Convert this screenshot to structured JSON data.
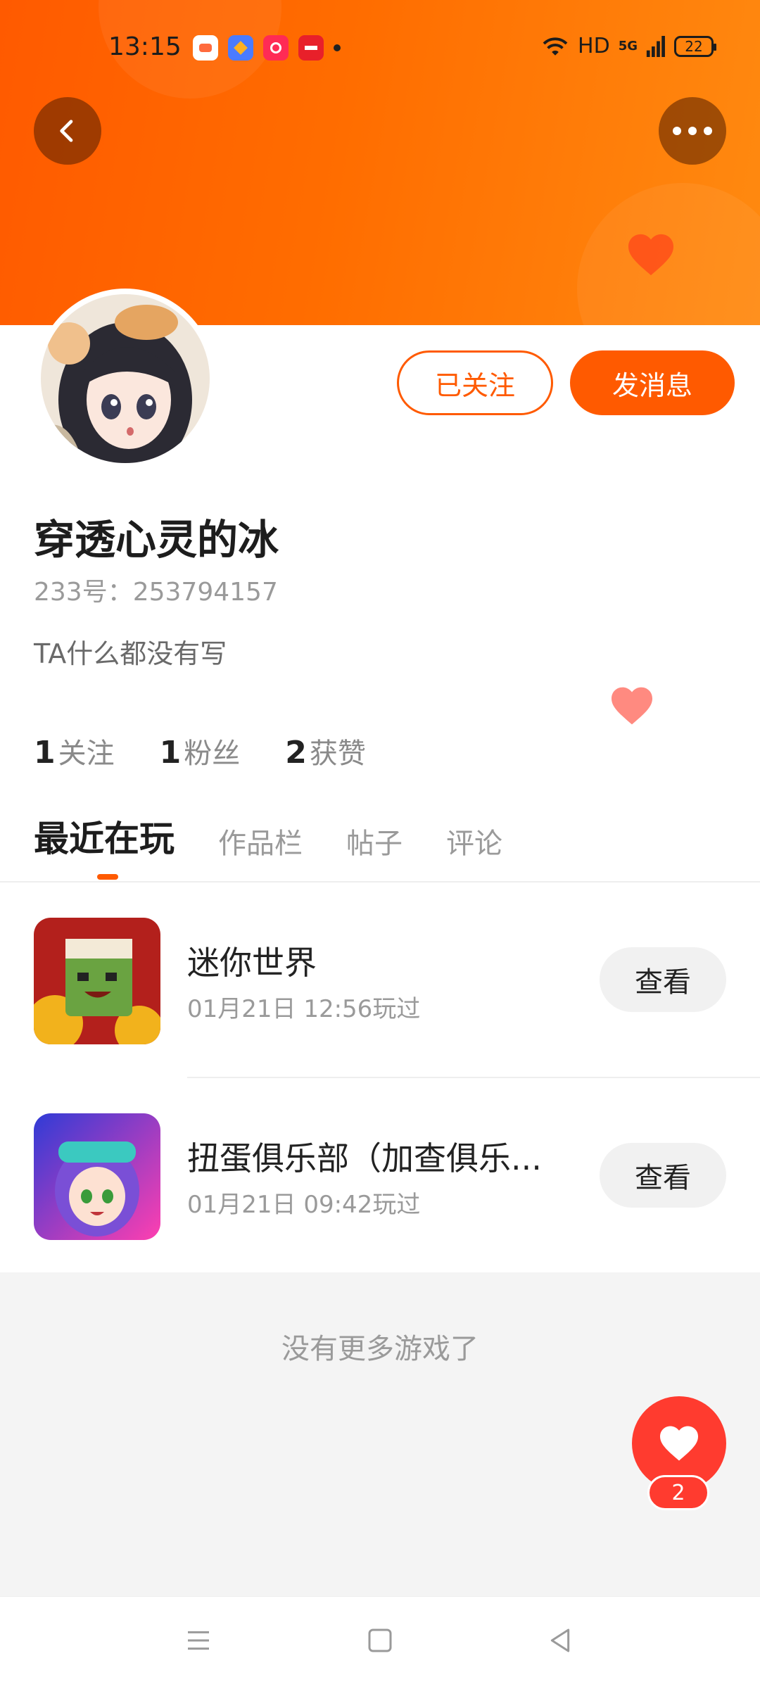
{
  "status_bar": {
    "time": "13:15",
    "network": "HD",
    "signal": "5G",
    "battery": "22"
  },
  "profile": {
    "username": "穿透心灵的冰",
    "uid": "233号：253794157",
    "bio": "TA什么都没有写",
    "follow_label": "已关注",
    "message_label": "发消息",
    "stats": {
      "following_count": "1",
      "following_label": "关注",
      "fans_count": "1",
      "fans_label": "粉丝",
      "likes_count": "2",
      "likes_label": "获赞"
    }
  },
  "tabs": [
    {
      "label": "最近在玩",
      "active": true
    },
    {
      "label": "作品栏",
      "active": false
    },
    {
      "label": "帖子",
      "active": false
    },
    {
      "label": "评论",
      "active": false
    }
  ],
  "games": [
    {
      "name": "迷你世界",
      "played": "01月21日 12:56玩过",
      "button": "查看",
      "icon": "mini-world-icon"
    },
    {
      "name": "扭蛋俱乐部（加查俱乐...",
      "played": "01月21日 09:42玩过",
      "button": "查看",
      "icon": "gacha-club-icon"
    }
  ],
  "no_more_text": "没有更多游戏了",
  "like_fab": {
    "count": "2"
  },
  "colors": {
    "accent": "#ff5a00",
    "like": "#ff3b2f",
    "banner_end": "#ff8a10"
  }
}
